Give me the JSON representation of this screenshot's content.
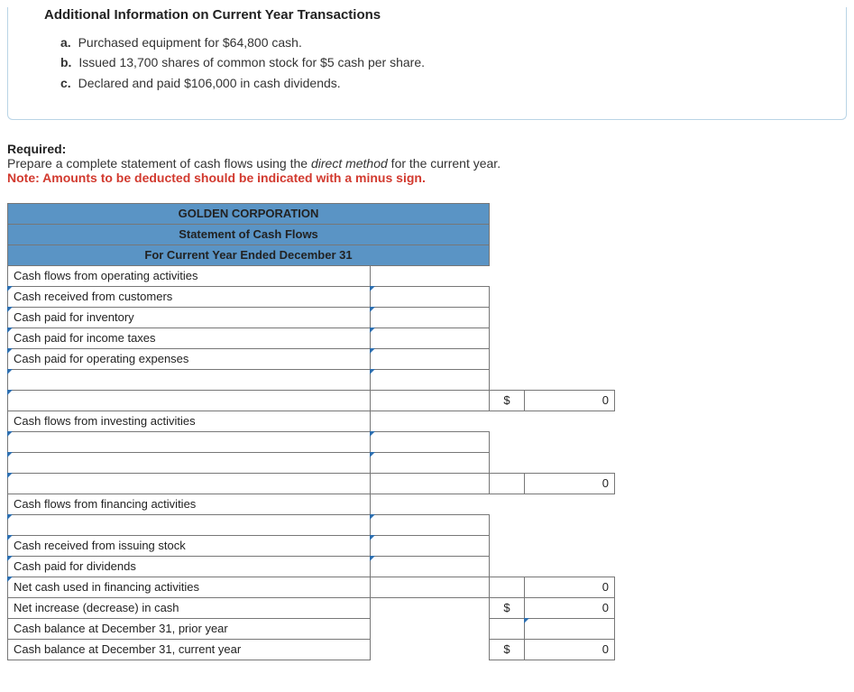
{
  "info": {
    "title": "Additional Information on Current Year Transactions",
    "items": [
      {
        "marker": "a.",
        "text": "Purchased equipment for $64,800 cash."
      },
      {
        "marker": "b.",
        "text": "Issued 13,700 shares of common stock for $5 cash per share."
      },
      {
        "marker": "c.",
        "text": "Declared and paid $106,000 in cash dividends."
      }
    ]
  },
  "required": {
    "label": "Required:",
    "text_pre": "Prepare a complete statement of cash flows using the ",
    "text_em": "direct method",
    "text_post": " for the current year.",
    "note": "Note: Amounts to be deducted should be indicated with a minus sign."
  },
  "stmt": {
    "h1": "GOLDEN CORPORATION",
    "h2": "Statement of Cash Flows",
    "h3": "For Current Year Ended December 31",
    "rows": {
      "op_head": "Cash flows from operating activities",
      "op_1": "Cash received from customers",
      "op_2": "Cash paid for inventory",
      "op_3": "Cash paid for income taxes",
      "op_4": "Cash paid for operating expenses",
      "op_sub_sym": "$",
      "op_sub_val": "0",
      "inv_head": "Cash flows from investing activities",
      "inv_sub_val": "0",
      "fin_head": "Cash flows from financing activities",
      "fin_1": "Cash received from issuing stock",
      "fin_2": "Cash paid for dividends",
      "fin_3": "Net cash used in financing activities",
      "fin_3_val": "0",
      "net_change": "Net increase (decrease) in cash",
      "net_change_sym": "$",
      "net_change_val": "0",
      "prior": "Cash balance at December 31, prior year",
      "curr": "Cash balance at December 31, current year",
      "curr_sym": "$",
      "curr_val": "0"
    }
  }
}
